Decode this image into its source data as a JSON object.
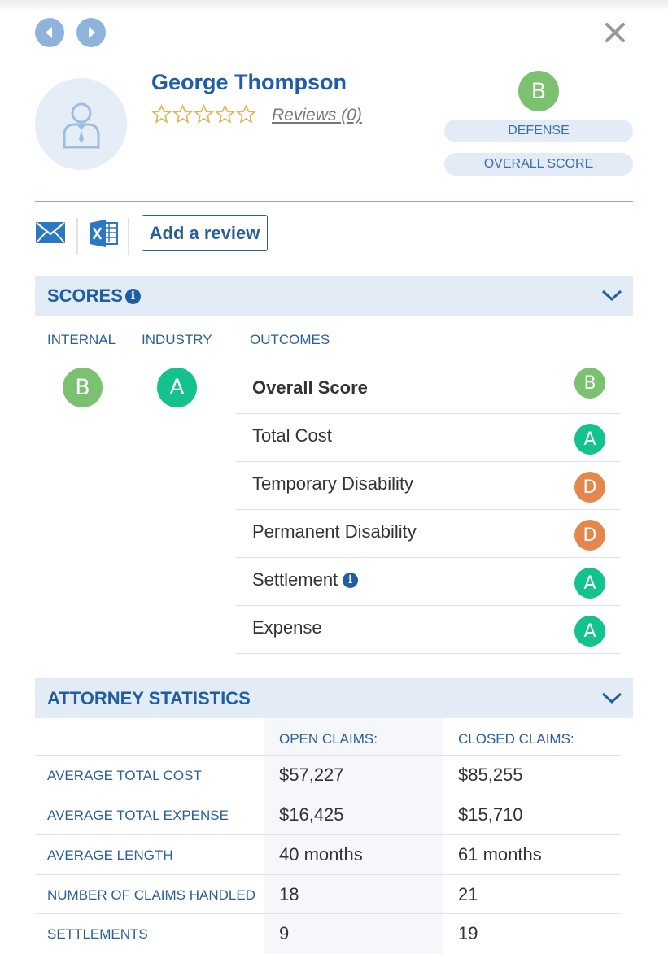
{
  "profile": {
    "name": "George Thompson",
    "reviews_link": "Reviews (0)",
    "rating_stars": 0,
    "rating_max": 5,
    "top_grade": "B",
    "role_label": "DEFENSE",
    "overall_score_label": "OVERALL SCORE"
  },
  "actions": {
    "add_review": "Add a review"
  },
  "scores": {
    "title": "SCORES",
    "info_glyph": "i",
    "internal_label": "INTERNAL",
    "internal_grade": "B",
    "industry_label": "INDUSTRY",
    "industry_grade": "A",
    "outcomes_label": "OUTCOMES",
    "outcomes": [
      {
        "label": "Overall Score",
        "grade": "B"
      },
      {
        "label": "Total Cost",
        "grade": "A"
      },
      {
        "label": "Temporary Disability",
        "grade": "D"
      },
      {
        "label": "Permanent Disability",
        "grade": "D"
      },
      {
        "label": "Settlement",
        "grade": "A"
      },
      {
        "label": "Expense",
        "grade": "A"
      }
    ]
  },
  "statistics": {
    "title": "ATTORNEY STATISTICS",
    "open_header": "OPEN CLAIMS:",
    "closed_header": "CLOSED CLAIMS:",
    "rows": [
      {
        "label": "AVERAGE TOTAL COST",
        "open": "$57,227",
        "closed": "$85,255"
      },
      {
        "label": "AVERAGE TOTAL EXPENSE",
        "open": "$16,425",
        "closed": "$15,710"
      },
      {
        "label": "AVERAGE LENGTH",
        "open": "40 months",
        "closed": "61 months"
      },
      {
        "label": "NUMBER OF CLAIMS HANDLED",
        "open": "18",
        "closed": "21"
      },
      {
        "label": "SETTLEMENTS",
        "open": "9",
        "closed": "19"
      }
    ]
  },
  "colors": {
    "grade_A": "#14c28e",
    "grade_B": "#7ac170",
    "grade_D": "#e5874c",
    "accent": "#1f5da4",
    "section_bg": "#e3ecf6"
  },
  "icons": [
    "previous-icon",
    "next-icon",
    "close-icon",
    "user-avatar-icon",
    "star-icon",
    "mail-icon",
    "excel-icon",
    "info-icon",
    "chevron-down-icon"
  ]
}
